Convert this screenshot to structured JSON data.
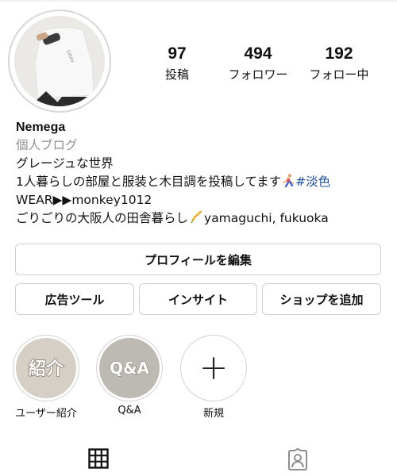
{
  "profile": {
    "username": "Nemega",
    "category": "個人ブログ",
    "bio_lines": [
      "グレージュな世界",
      "1人暮らしの部屋と服装と木目調を投稿してます",
      "WEAR▶▶monkey1012",
      "ごりごりの大阪人の田舎暮らし"
    ],
    "hashtag": "#淡色",
    "location": "yamaguchi, fukuoka"
  },
  "stats": {
    "posts": {
      "value": "97",
      "label": "投稿"
    },
    "followers": {
      "value": "494",
      "label": "フォロワー"
    },
    "following": {
      "value": "192",
      "label": "フォロー中"
    }
  },
  "buttons": {
    "edit_profile": "プロフィールを編集",
    "ad_tools": "広告ツール",
    "insights": "インサイト",
    "add_shop": "ショップを追加"
  },
  "highlights": [
    {
      "label": "ユーザー紹介",
      "cover_text": "紹介"
    },
    {
      "label": "Q&A",
      "cover_text": "Q&A"
    },
    {
      "label": "新規",
      "cover_text": "+"
    }
  ],
  "icons": {
    "grid_tab": "grid-icon",
    "tagged_tab": "tagged-person-icon",
    "runner_emoji": "runner-icon",
    "rice_emoji": "rice-ear-icon"
  },
  "colors": {
    "hashtag": "#1f4f96",
    "category": "#8e8e8e",
    "border": "#cfcfcf"
  }
}
